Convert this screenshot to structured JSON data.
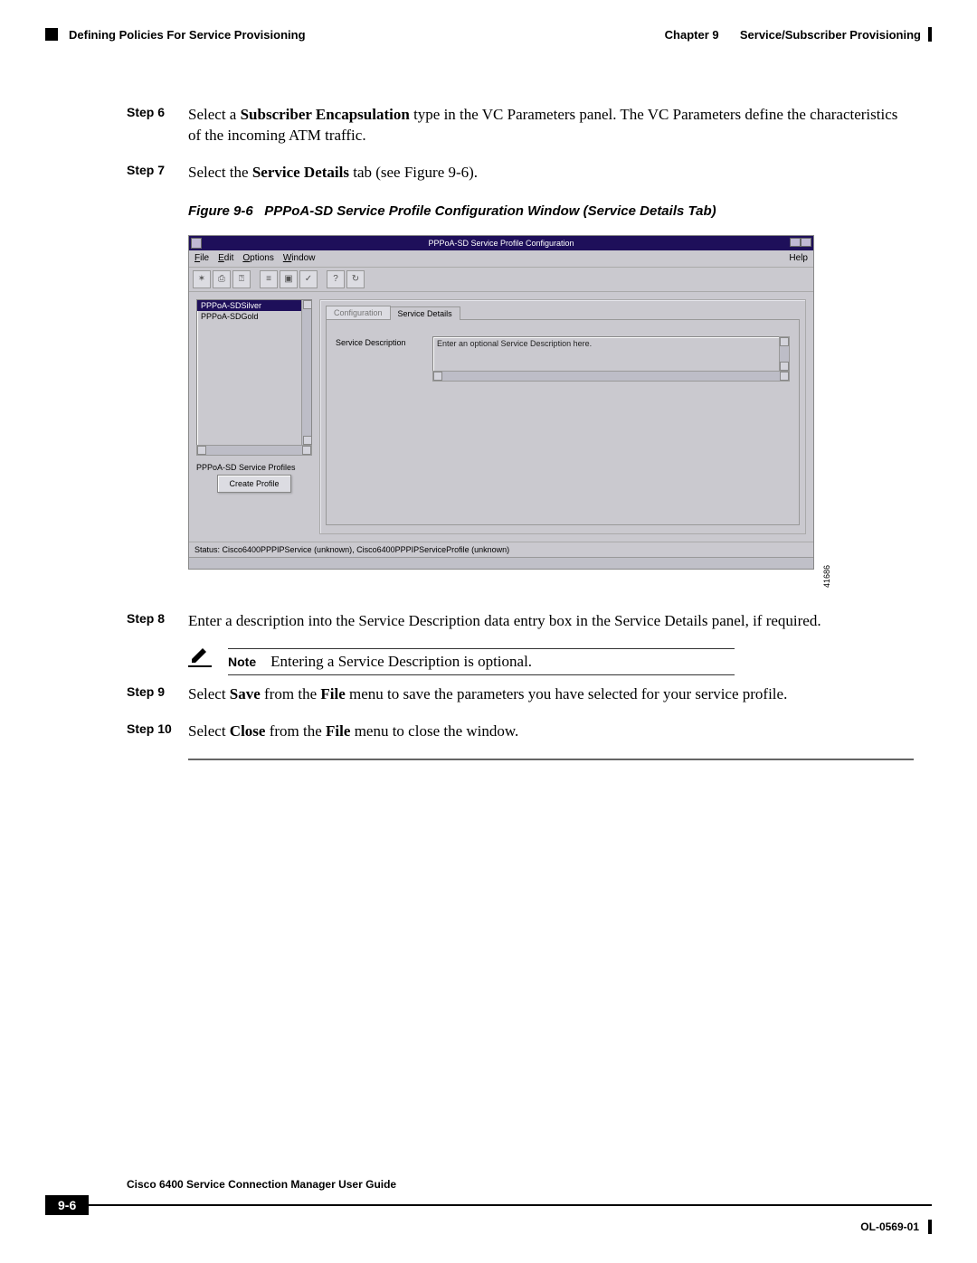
{
  "header": {
    "chapter": "Chapter 9",
    "chapter_title": "Service/Subscriber Provisioning",
    "section": "Defining Policies For Service Provisioning"
  },
  "steps": {
    "s6": {
      "label": "Step 6",
      "pre": "Select a ",
      "bold": "Subscriber Encapsulation",
      "post": " type in the VC Parameters panel. The VC Parameters define the characteristics of the incoming ATM traffic."
    },
    "s7": {
      "label": "Step 7",
      "pre": "Select the ",
      "bold": "Service Details",
      "post": " tab (see Figure 9-6)."
    },
    "s8": {
      "label": "Step 8",
      "text": "Enter a description into the Service Description data entry box in the Service Details panel, if required."
    },
    "s9": {
      "label": "Step 9",
      "pre": "Select ",
      "bold1": "Save",
      "mid": " from the ",
      "bold2": "File",
      "post": " menu to save the parameters you have selected for your service profile."
    },
    "s10": {
      "label": "Step 10",
      "pre": "Select ",
      "bold1": "Close",
      "mid": " from the ",
      "bold2": "File",
      "post": " menu to close the window."
    }
  },
  "figure": {
    "caption_label": "Figure 9-6",
    "caption_text": "PPPoA-SD Service Profile Configuration Window (Service Details Tab)",
    "id": "41686"
  },
  "gui": {
    "title": "PPPoA-SD Service Profile Configuration",
    "menus": {
      "file": "File",
      "edit": "Edit",
      "options": "Options",
      "window": "Window",
      "help": "Help"
    },
    "list": {
      "items": [
        "PPPoA-SDSilver",
        "PPPoA-SDGold"
      ],
      "selected_index": 0
    },
    "left_panel_label": "PPPoA-SD Service Profiles",
    "create_button": "Create Profile",
    "tabs": {
      "configuration": "Configuration",
      "service_details": "Service Details"
    },
    "field_label": "Service Description",
    "field_value": "Enter an optional Service Description here.",
    "status": "Status: Cisco6400PPPIPService (unknown), Cisco6400PPPIPServiceProfile (unknown)"
  },
  "note": {
    "label": "Note",
    "text": "Entering a Service Description is optional."
  },
  "footer": {
    "guide": "Cisco 6400 Service Connection Manager User Guide",
    "page": "9-6",
    "doc": "OL-0569-01"
  }
}
